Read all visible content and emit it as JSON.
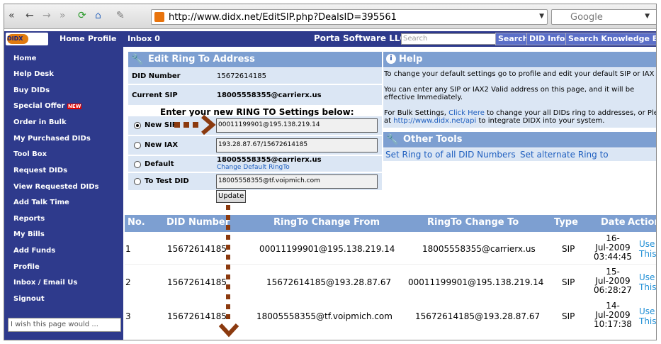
{
  "browser": {
    "url": "http://www.didx.net/EditSIP.php?DealsID=395561",
    "search_engine": "Google"
  },
  "topnav": {
    "home": "Home",
    "profile": "Profile",
    "inbox": "Inbox 0",
    "company": "Porta Software LLC",
    "search_placeholder": "Search",
    "search_btn": "Search",
    "did_info_btn": "DID Info",
    "search_kb_btn": "Search Knowledge Base",
    "logo_text": "DIDX"
  },
  "sidebar": {
    "items": [
      "Home",
      "Help Desk",
      "Buy DIDs",
      "Special Offer",
      "Order in Bulk",
      "My Purchased DIDs",
      "Tool Box",
      "Request DIDs",
      "View Requested DIDs",
      "Add Talk Time",
      "Reports",
      "My Bills",
      "Add Funds",
      "Profile",
      "Inbox / Email Us",
      "Signout"
    ],
    "new_badge": "NEW",
    "feedback_placeholder": "I wish this page would ..."
  },
  "edit": {
    "title": "Edit Ring To Address",
    "did_label": "DID Number",
    "did_value": "15672614185",
    "current_label": "Current SIP",
    "current_value": "18005558355@carrierx.us",
    "instruction": "Enter your new RING TO Settings below:",
    "new_sip_label": "New SIP",
    "new_sip_value": "00011199901@195.138.219.14",
    "new_iax_label": "New IAX",
    "new_iax_value": "193.28.87.67/15672614185",
    "default_label": "Default",
    "default_value": "18005558355@carrierx.us",
    "default_link": "Change Default RingTo",
    "test_label": "To Test DID",
    "test_value": "18005558355@tf.voipmich.com",
    "update_btn": "Update"
  },
  "help": {
    "title": "Help",
    "p1": "To change your default settings go to profile and edit your default SIP or IAX settings.",
    "p2": "You can enter any SIP or IAX2 Valid address on this page, and it will be effective Immediately.",
    "p3a": "For Bulk Settings,",
    "p3link": "Click Here",
    "p3b": "to change your all DIDs ring to addresses, or Please look",
    "p3c": "at",
    "p3url": "http://www.didx.net/api",
    "p3d": "to integrate DIDX into your system.",
    "tools_title": "Other Tools",
    "tool1": "Set Ring to of all DID Numbers",
    "tool2": "Set alternate Ring to"
  },
  "history": {
    "headers": [
      "No.",
      "DID Number",
      "RingTo Change From",
      "RingTo Change To",
      "Type",
      "Date",
      "Action"
    ],
    "rows": [
      {
        "no": "1",
        "did": "15672614185",
        "from": "00011199901@195.138.219.14",
        "to": "18005558355@carrierx.us",
        "type": "SIP",
        "date1": "16-",
        "date2": "Jul-2009",
        "date3": "03:44:45",
        "action1": "Use",
        "action2": "This"
      },
      {
        "no": "2",
        "did": "15672614185",
        "from": "15672614185@193.28.87.67",
        "to": "00011199901@195.138.219.14",
        "type": "SIP",
        "date1": "15-",
        "date2": "Jul-2009",
        "date3": "06:28:27",
        "action1": "Use",
        "action2": "This"
      },
      {
        "no": "3",
        "did": "15672614185",
        "from": "18005558355@tf.voipmich.com",
        "to": "15672614185@193.28.87.67",
        "type": "SIP",
        "date1": "14-",
        "date2": "Jul-2009",
        "date3": "10:17:38",
        "action1": "Use",
        "action2": "This"
      }
    ]
  },
  "colors": {
    "nav": "#2e3a8c",
    "header": "#7d9fd1",
    "row": "#dbe6f4",
    "arrow": "#8b3a0f",
    "link": "#1f5fbf"
  }
}
